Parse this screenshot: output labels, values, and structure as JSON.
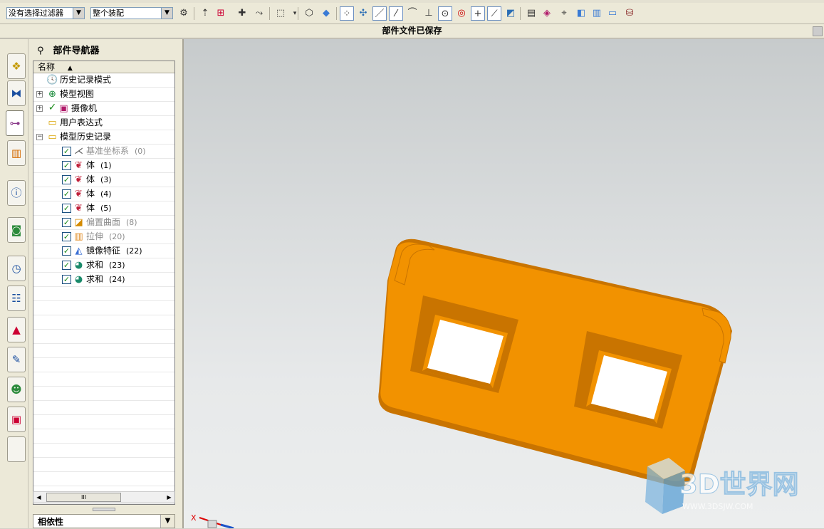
{
  "toolbar": {
    "filter_value": "没有选择过滤器",
    "assembly_value": "整个装配",
    "icons": [
      "snap-icon",
      "point-icon",
      "paint-icon",
      "cube-wire-icon",
      "cube-solid-icon",
      "endpoint-icon",
      "midpoint-icon",
      "line-icon",
      "arc-icon",
      "tangent-icon",
      "circle-center-icon",
      "quadrant-icon",
      "intersection-icon",
      "plane-icon",
      "book-icon",
      "face-icon",
      "analysis-icon",
      "shade-icon",
      "chart-icon",
      "sheet-icon",
      "tools-icon"
    ]
  },
  "status": {
    "message": "部件文件已保存"
  },
  "left_strip": {
    "buttons": [
      "assembly-navigator-icon",
      "constraint-navigator-icon",
      "part-navigator-icon",
      "reuse-library-icon",
      "info-icon",
      "web-browser-icon",
      "history-icon",
      "process-studio-icon",
      "visualization-icon",
      "roles-icon",
      "system-materials-icon",
      "palette-icon",
      "blank-tab-icon"
    ]
  },
  "navigator": {
    "title": "部件导航器",
    "column_header": "名称",
    "items": [
      {
        "label": "历史记录模式",
        "num": "",
        "icon": "clock-icon",
        "indent": 0,
        "expander": "",
        "checked": false,
        "grey": false
      },
      {
        "label": "模型视图",
        "num": "",
        "icon": "model-views-icon",
        "indent": 0,
        "expander": "+",
        "checked": false,
        "grey": false
      },
      {
        "label": "摄像机",
        "num": "",
        "icon": "camera-icon",
        "indent": 0,
        "expander": "+",
        "checked": true,
        "grey": false
      },
      {
        "label": "用户表达式",
        "num": "",
        "icon": "folder-icon",
        "indent": 0,
        "expander": "",
        "checked": false,
        "grey": false
      },
      {
        "label": "模型历史记录",
        "num": "",
        "icon": "folder-open-icon",
        "indent": 0,
        "expander": "-",
        "checked": false,
        "grey": false
      },
      {
        "label": "基准坐标系",
        "num": "(0)",
        "icon": "datum-csys-icon",
        "indent": 1,
        "expander": "",
        "checked": true,
        "grey": true
      },
      {
        "label": "体",
        "num": "(1)",
        "icon": "body-icon",
        "indent": 1,
        "expander": "",
        "checked": true,
        "grey": false
      },
      {
        "label": "体",
        "num": "(3)",
        "icon": "body-icon",
        "indent": 1,
        "expander": "",
        "checked": true,
        "grey": false
      },
      {
        "label": "体",
        "num": "(4)",
        "icon": "body-icon",
        "indent": 1,
        "expander": "",
        "checked": true,
        "grey": false
      },
      {
        "label": "体",
        "num": "(5)",
        "icon": "body-icon",
        "indent": 1,
        "expander": "",
        "checked": true,
        "grey": false
      },
      {
        "label": "偏置曲面",
        "num": "(8)",
        "icon": "offset-surface-icon",
        "indent": 1,
        "expander": "",
        "checked": true,
        "grey": true
      },
      {
        "label": "拉伸",
        "num": "(20)",
        "icon": "extrude-icon",
        "indent": 1,
        "expander": "",
        "checked": true,
        "grey": true
      },
      {
        "label": "镜像特征",
        "num": "(22)",
        "icon": "mirror-feature-icon",
        "indent": 1,
        "expander": "",
        "checked": true,
        "grey": false
      },
      {
        "label": "求和",
        "num": "(23)",
        "icon": "unite-icon",
        "indent": 1,
        "expander": "",
        "checked": true,
        "grey": false
      },
      {
        "label": "求和",
        "num": "(24)",
        "icon": "unite-icon",
        "indent": 1,
        "expander": "",
        "checked": true,
        "grey": false
      }
    ],
    "dependency_label": "相依性"
  },
  "viewport": {
    "part_color": "#f29200",
    "part_shadow": "#c97400",
    "axis_x_label": "X",
    "watermark_text": "3D世界网",
    "watermark_url": "WWW.3DSJW.COM",
    "watermark_color": "#7fb6df"
  }
}
